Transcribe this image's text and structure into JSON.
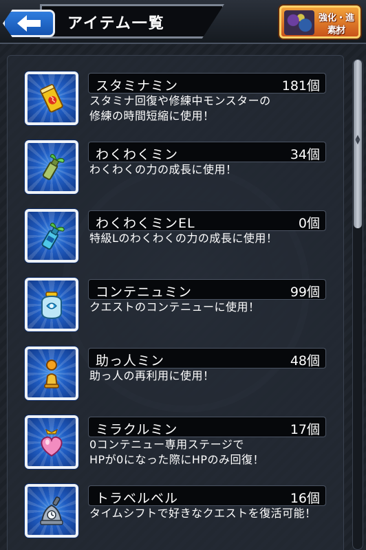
{
  "header": {
    "title": "アイテム一覧",
    "evolve_line1": "強化・進化",
    "evolve_line2": "素材"
  },
  "items": [
    {
      "name": "スタミナミン",
      "count": "181個",
      "desc1": "スタミナ回復や修練中モンスターの",
      "desc2": "修練の時間短縮に使用！",
      "icon": "stamina-can-icon"
    },
    {
      "name": "わくわくミン",
      "count": "34個",
      "desc1": "わくわくの力の成長に使用！",
      "desc2": "",
      "icon": "sprout-bottle-icon"
    },
    {
      "name": "わくわくミンEL",
      "count": "0個",
      "desc1": "特級Lのわくわくの力の成長に使用！",
      "desc2": "",
      "icon": "sprout-bottle-el-icon"
    },
    {
      "name": "コンテニュミン",
      "count": "99個",
      "desc1": "クエストのコンテニューに使用！",
      "desc2": "",
      "icon": "continue-jar-icon"
    },
    {
      "name": "助っ人ミン",
      "count": "48個",
      "desc1": "助っ人の再利用に使用！",
      "desc2": "",
      "icon": "helper-pawn-icon"
    },
    {
      "name": "ミラクルミン",
      "count": "17個",
      "desc1": "0コンテニュー専用ステージで",
      "desc2": "HPが0になった際にHPのみ回復！",
      "icon": "heart-potion-icon"
    },
    {
      "name": "トラベルベル",
      "count": "16個",
      "desc1": "タイムシフトで好きなクエストを復活可能！",
      "desc2": "",
      "icon": "travel-bell-icon"
    }
  ]
}
